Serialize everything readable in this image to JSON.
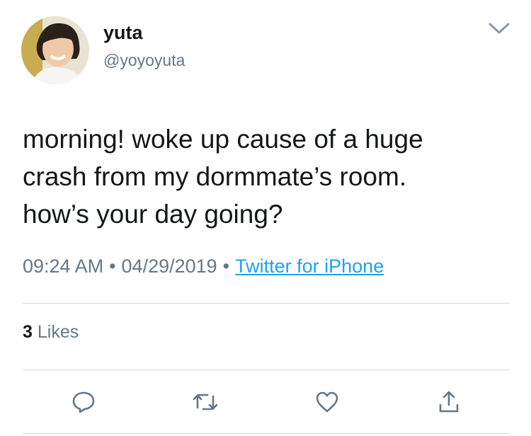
{
  "user": {
    "display_name": "yuta",
    "handle": "@yoyoyuta",
    "avatar_icon": "profile-photo"
  },
  "tweet": {
    "text": "morning! woke up cause of a huge\ncrash from my dormmate’s room.\nhow’s your day going?",
    "time": "09:24 AM",
    "date": "04/29/2019",
    "separator": "•",
    "source": "Twitter for iPhone"
  },
  "stats": {
    "likes_count": "3",
    "likes_label": "Likes"
  },
  "actions": [
    "reply-icon",
    "retweet-icon",
    "like-icon",
    "share-icon"
  ],
  "colors": {
    "text": "#14171a",
    "secondary": "#657786",
    "link": "#1da1f2",
    "divider": "#d5d9dd"
  }
}
